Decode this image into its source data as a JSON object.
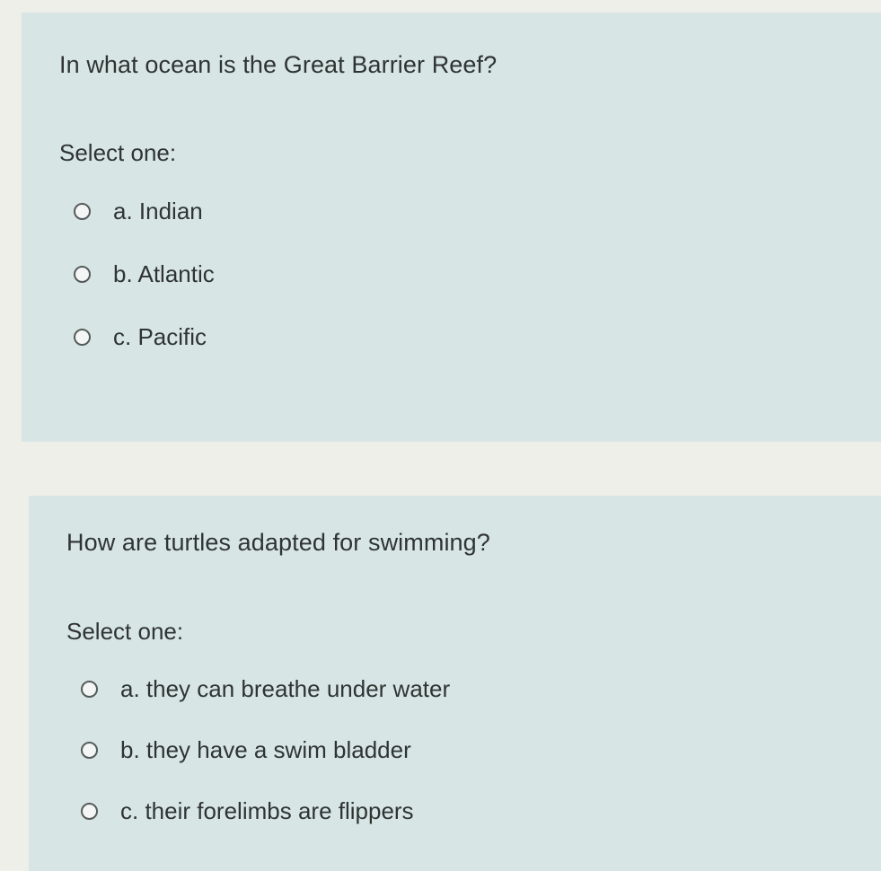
{
  "questions": [
    {
      "text": "In what ocean is the Great Barrier Reef?",
      "prompt": "Select one:",
      "options": [
        {
          "label": "a. Indian"
        },
        {
          "label": "b. Atlantic"
        },
        {
          "label": "c. Pacific"
        }
      ]
    },
    {
      "text": "How are turtles adapted for swimming?",
      "prompt": "Select one:",
      "options": [
        {
          "label": "a. they can breathe under water"
        },
        {
          "label": "b. they have a swim bladder"
        },
        {
          "label": "c. their forelimbs are flippers"
        }
      ]
    }
  ],
  "colors": {
    "page_background": "#eeefe9",
    "card_background": "#d7e6e4",
    "text": "#2f3433"
  }
}
